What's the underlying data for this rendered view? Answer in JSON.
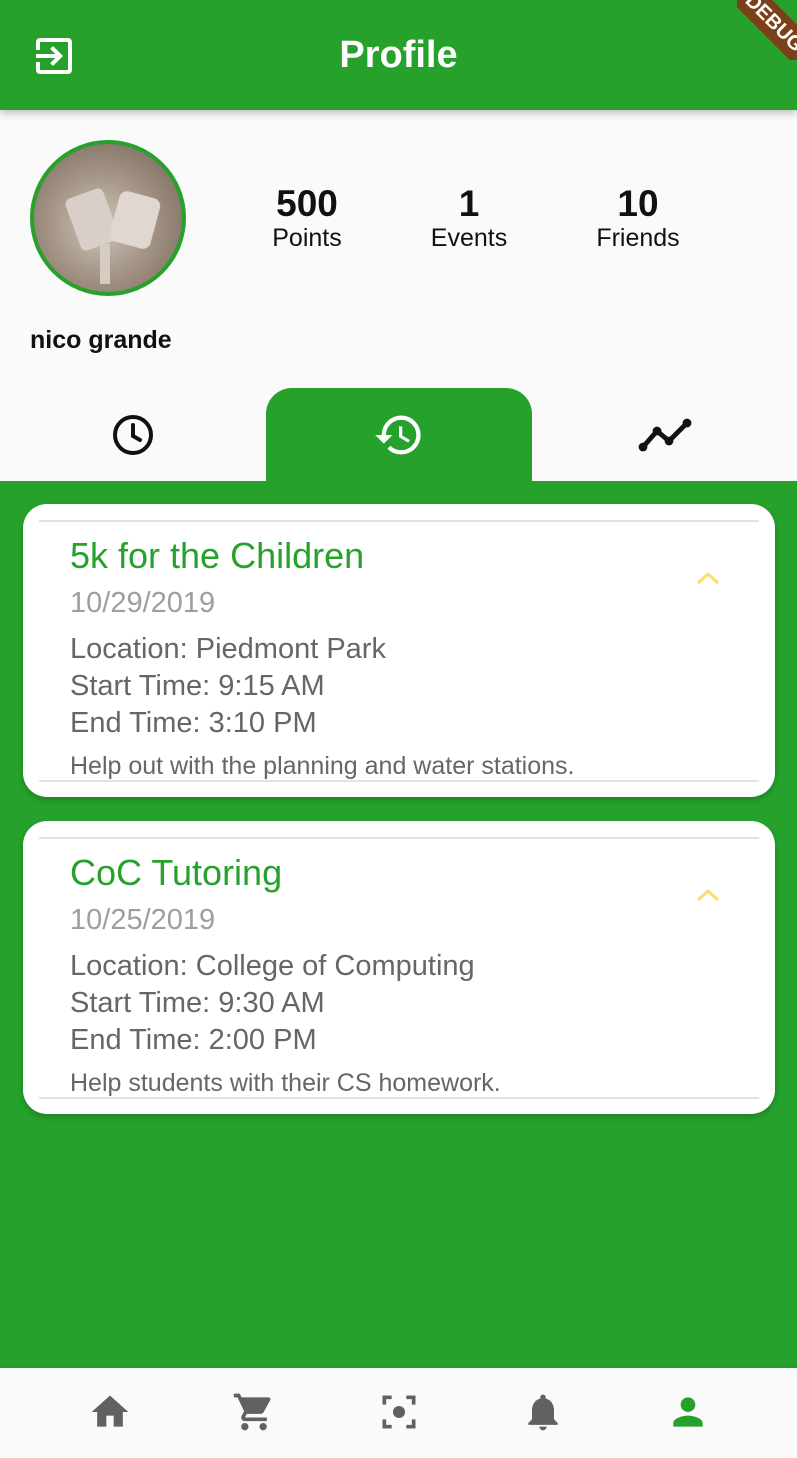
{
  "app_bar": {
    "title": "Profile",
    "debug_banner": "DEBUG"
  },
  "profile": {
    "name": "nico grande",
    "stats": [
      {
        "value": "500",
        "label": "Points"
      },
      {
        "value": "1",
        "label": "Events"
      },
      {
        "value": "10",
        "label": "Friends"
      }
    ]
  },
  "tabs": [
    {
      "icon": "clock-icon",
      "active": false
    },
    {
      "icon": "history-icon",
      "active": true
    },
    {
      "icon": "trending-icon",
      "active": false
    }
  ],
  "events": [
    {
      "title": "5k for the Children",
      "date": "10/29/2019",
      "location": "Location: Piedmont Park",
      "start": "Start Time: 9:15 AM",
      "end": "End Time: 3:10 PM",
      "description": "Help out with the planning and water stations."
    },
    {
      "title": "CoC Tutoring",
      "date": "10/25/2019",
      "location": "Location: College of Computing",
      "start": "Start Time: 9:30 AM",
      "end": "End Time: 2:00 PM",
      "description": "Help students with their CS homework."
    }
  ],
  "bottom_nav": [
    {
      "icon": "home-icon",
      "active": false
    },
    {
      "icon": "cart-icon",
      "active": false
    },
    {
      "icon": "scan-icon",
      "active": false
    },
    {
      "icon": "bell-icon",
      "active": false
    },
    {
      "icon": "person-icon",
      "active": true
    }
  ],
  "colors": {
    "primary": "#25A12C",
    "accent_chevron": "#F9DE6E",
    "inactive_icon": "#616161"
  }
}
